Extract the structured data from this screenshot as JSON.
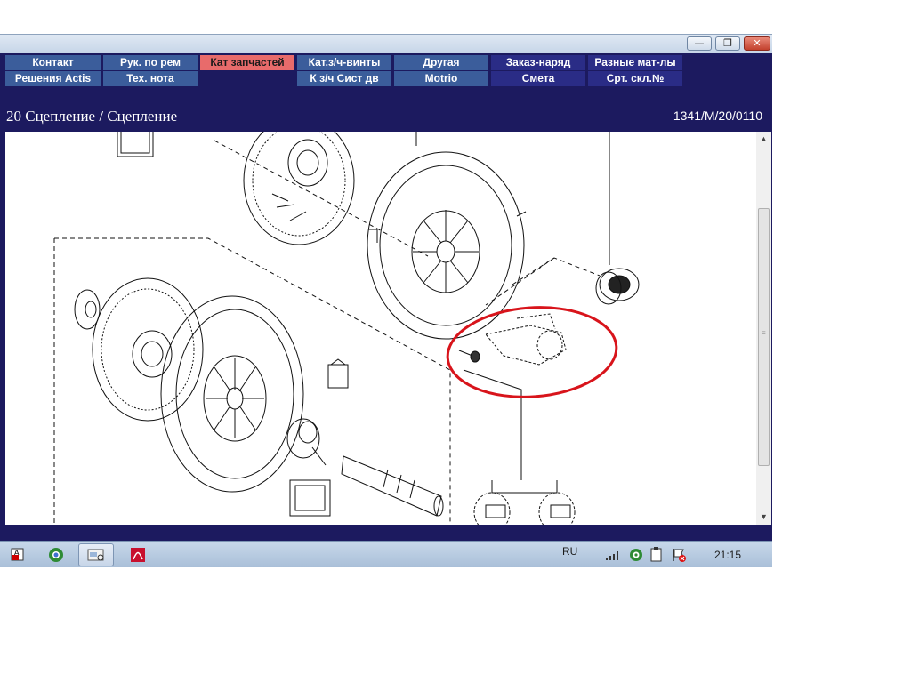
{
  "window": {
    "buttons": {
      "minimize": "—",
      "maximize": "❐",
      "close": "✕"
    }
  },
  "menu": {
    "row1": [
      "Контакт",
      "Рук. по рем",
      "Кат запчастей",
      "Кат.з/ч-винты",
      "Другая",
      "Заказ-наряд",
      "Разные мат-лы"
    ],
    "row2": [
      "Решения Actis",
      "Тех. нота",
      "",
      "К з/ч Сист дв",
      "Motrio",
      "Смета",
      "Срт. скл.№"
    ],
    "selected": "Кат запчастей"
  },
  "header": {
    "title": "20 Сцепление / Сцепление",
    "code": "1341/M/20/0110"
  },
  "taskbar": {
    "apps": [
      "acrobat-reader-icon",
      "chrome-icon",
      "explorer-icon",
      "pdf-icon"
    ],
    "lang": "RU",
    "clock": "21:15",
    "tray_icons": [
      "network-icon",
      "app-eye-icon",
      "clipboard-icon",
      "flag-icon"
    ]
  },
  "colors": {
    "navy": "#1c1a5f",
    "tab": "#3b5d9b",
    "tab_selected": "#e86b6b",
    "highlight_ellipse": "#d8141b"
  }
}
